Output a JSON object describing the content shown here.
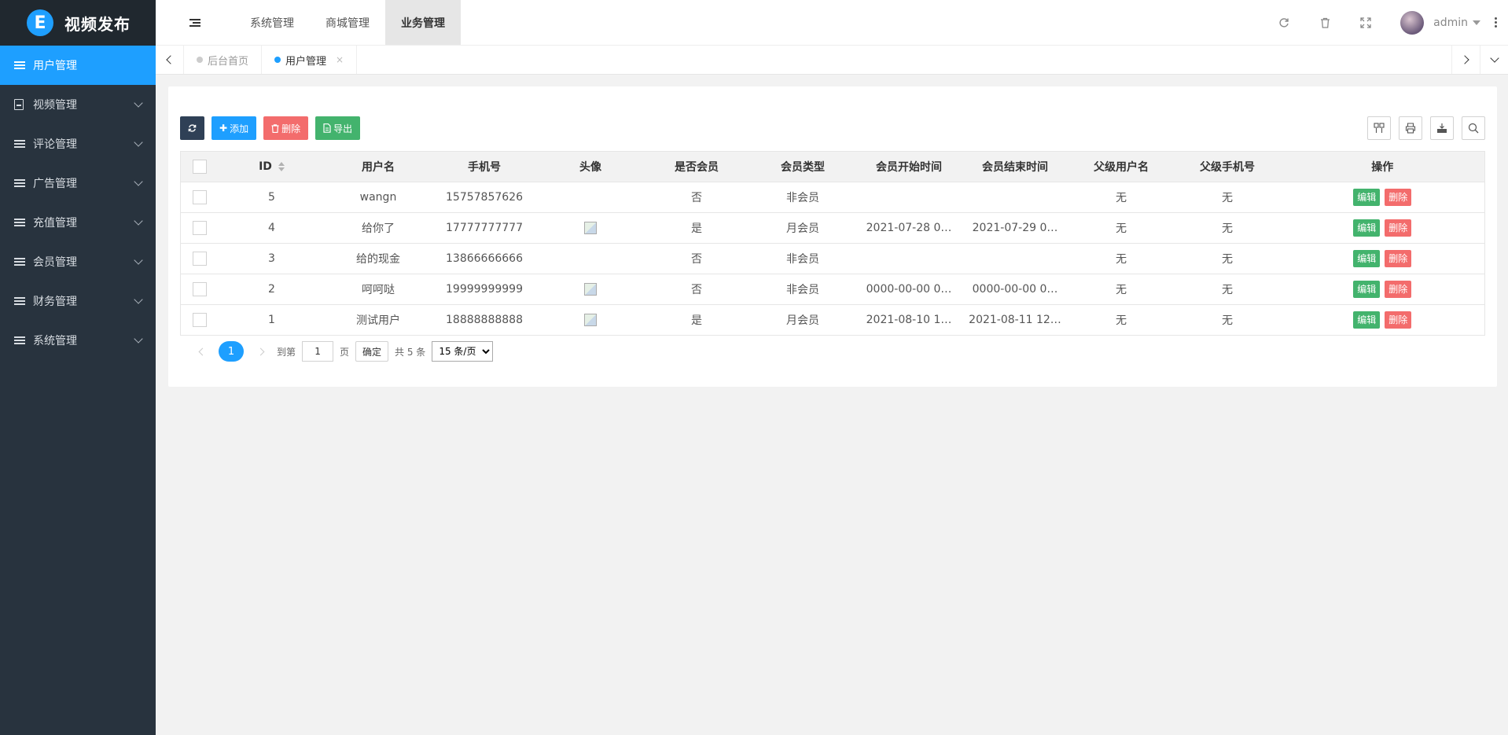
{
  "app": {
    "title": "视频发布",
    "logo_letter": "E"
  },
  "sidebar": {
    "items": [
      {
        "label": "用户管理",
        "icon": "list-icon",
        "active": true,
        "expandable": false
      },
      {
        "label": "视频管理",
        "icon": "doc-icon",
        "active": false,
        "expandable": true
      },
      {
        "label": "评论管理",
        "icon": "list-icon",
        "active": false,
        "expandable": true
      },
      {
        "label": "广告管理",
        "icon": "list-icon",
        "active": false,
        "expandable": true
      },
      {
        "label": "充值管理",
        "icon": "list-icon",
        "active": false,
        "expandable": true
      },
      {
        "label": "会员管理",
        "icon": "list-icon",
        "active": false,
        "expandable": true
      },
      {
        "label": "财务管理",
        "icon": "list-icon",
        "active": false,
        "expandable": true
      },
      {
        "label": "系统管理",
        "icon": "list-icon",
        "active": false,
        "expandable": true
      }
    ]
  },
  "header": {
    "tabs": [
      {
        "label": "系统管理",
        "active": false
      },
      {
        "label": "商城管理",
        "active": false
      },
      {
        "label": "业务管理",
        "active": true
      }
    ],
    "user": "admin"
  },
  "page_tabs": [
    {
      "label": "后台首页",
      "current": false,
      "closable": false
    },
    {
      "label": "用户管理",
      "current": true,
      "closable": true,
      "close_glyph": "×"
    }
  ],
  "toolbar": {
    "add_label": "添加",
    "delete_label": "删除",
    "export_label": "导出"
  },
  "table": {
    "columns": [
      "ID",
      "用户名",
      "手机号",
      "头像",
      "是否会员",
      "会员类型",
      "会员开始时间",
      "会员结束时间",
      "父级用户名",
      "父级手机号",
      "操作"
    ],
    "rows": [
      {
        "id": "5",
        "username": "wangn",
        "phone": "15757857626",
        "has_avatar": false,
        "is_member": "否",
        "member_type": "非会员",
        "start": "",
        "end": "",
        "parent_name": "无",
        "parent_phone": "无"
      },
      {
        "id": "4",
        "username": "给你了",
        "phone": "17777777777",
        "has_avatar": true,
        "is_member": "是",
        "member_type": "月会员",
        "start": "2021-07-28 0…",
        "end": "2021-07-29 0…",
        "parent_name": "无",
        "parent_phone": "无"
      },
      {
        "id": "3",
        "username": "给的现金",
        "phone": "13866666666",
        "has_avatar": false,
        "is_member": "否",
        "member_type": "非会员",
        "start": "",
        "end": "",
        "parent_name": "无",
        "parent_phone": "无"
      },
      {
        "id": "2",
        "username": "呵呵哒",
        "phone": "19999999999",
        "has_avatar": true,
        "is_member": "否",
        "member_type": "非会员",
        "start": "0000-00-00 0…",
        "end": "0000-00-00 0…",
        "parent_name": "无",
        "parent_phone": "无"
      },
      {
        "id": "1",
        "username": "测试用户",
        "phone": "18888888888",
        "has_avatar": true,
        "is_member": "是",
        "member_type": "月会员",
        "start": "2021-08-10 1…",
        "end": "2021-08-11 12…",
        "parent_name": "无",
        "parent_phone": "无"
      }
    ],
    "edit_label": "编辑",
    "delete_label": "删除"
  },
  "pagination": {
    "current_page": "1",
    "goto_prefix": "到第",
    "goto_value": "1",
    "goto_suffix": "页",
    "confirm_label": "确定",
    "total_text": "共 5 条",
    "page_size_selected": "15 条/页"
  },
  "colors": {
    "primary": "#1e9fff",
    "sidebar_bg": "#28333e",
    "danger": "#f36c6c",
    "success": "#43b36d"
  }
}
